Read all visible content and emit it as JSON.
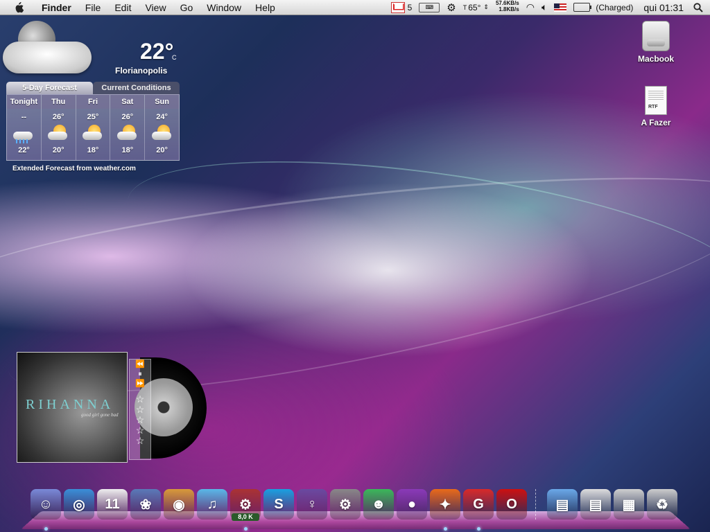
{
  "menubar": {
    "app": "Finder",
    "menus": [
      "File",
      "Edit",
      "View",
      "Go",
      "Window",
      "Help"
    ],
    "gmail_count": "5",
    "temperature": "65°",
    "net_up": "57.6KB/s",
    "net_down": "1.8KB/s",
    "battery_status": "(Charged)",
    "clock": "qui 01:31"
  },
  "weather": {
    "temp": "22°",
    "unit": "C",
    "city": "Florianopolis",
    "tabs": [
      "5-Day Forecast",
      "Current Conditions"
    ],
    "days": [
      {
        "name": "Tonight",
        "hi": "--",
        "lo": "22°",
        "icon": "rain"
      },
      {
        "name": "Thu",
        "hi": "26°",
        "lo": "20°",
        "icon": "partly-cloudy"
      },
      {
        "name": "Fri",
        "hi": "25°",
        "lo": "18°",
        "icon": "partly-cloudy"
      },
      {
        "name": "Sat",
        "hi": "26°",
        "lo": "18°",
        "icon": "partly-cloudy"
      },
      {
        "name": "Sun",
        "hi": "24°",
        "lo": "20°",
        "icon": "partly-cloudy"
      }
    ],
    "footer": "Extended Forecast from weather.com"
  },
  "desktop_icons": [
    {
      "label": "Macbook",
      "icon": "hard-drive-icon"
    },
    {
      "label": "A Fazer",
      "icon": "rtf-document-icon",
      "badge": "RTF"
    }
  ],
  "music": {
    "artist": "RIHANNA",
    "album": "good girl gone bad",
    "controls": [
      "⏪",
      "⏸",
      "⏩"
    ],
    "rating_stars": 5
  },
  "dock": {
    "items": [
      {
        "name": "finder",
        "glyph": "☺",
        "color": "#7a8ad8",
        "running": true
      },
      {
        "name": "safari",
        "glyph": "◎",
        "color": "#3a8fd8",
        "running": false
      },
      {
        "name": "ical",
        "glyph": "11",
        "color": "#eeeeee",
        "running": false
      },
      {
        "name": "iphoto",
        "glyph": "❀",
        "color": "#5a7ab8",
        "running": false
      },
      {
        "name": "photo-booth",
        "glyph": "◉",
        "color": "#d89a3a",
        "running": false
      },
      {
        "name": "itunes",
        "glyph": "♫",
        "color": "#5ab8e8",
        "running": false
      },
      {
        "name": "transmission",
        "glyph": "⚙",
        "color": "#aa3333",
        "running": true,
        "badge": "8,0 K"
      },
      {
        "name": "skype",
        "glyph": "S",
        "color": "#19a0e0",
        "running": false
      },
      {
        "name": "adium",
        "glyph": "♀",
        "color": "#6a4aa0",
        "running": false
      },
      {
        "name": "system-preferences",
        "glyph": "⚙",
        "color": "#888888",
        "running": false
      },
      {
        "name": "messenger",
        "glyph": "☻",
        "color": "#3ab85a",
        "running": false
      },
      {
        "name": "growl",
        "glyph": "●",
        "color": "#8a3ab8",
        "running": false
      },
      {
        "name": "firefox",
        "glyph": "✦",
        "color": "#e86a1a",
        "running": true
      },
      {
        "name": "crossover",
        "glyph": "G",
        "color": "#d82a2a",
        "running": true
      },
      {
        "name": "opera",
        "glyph": "O",
        "color": "#cc1111",
        "running": false
      },
      {
        "name": "folder",
        "glyph": "▤",
        "color": "#6aa8e8",
        "running": false
      },
      {
        "name": "folder-2",
        "glyph": "▤",
        "color": "#dddddd",
        "running": false
      },
      {
        "name": "downloads-stack",
        "glyph": "▦",
        "color": "#cfcfcf",
        "running": false
      },
      {
        "name": "trash",
        "glyph": "♻",
        "color": "#cccccc",
        "running": false
      }
    ]
  }
}
